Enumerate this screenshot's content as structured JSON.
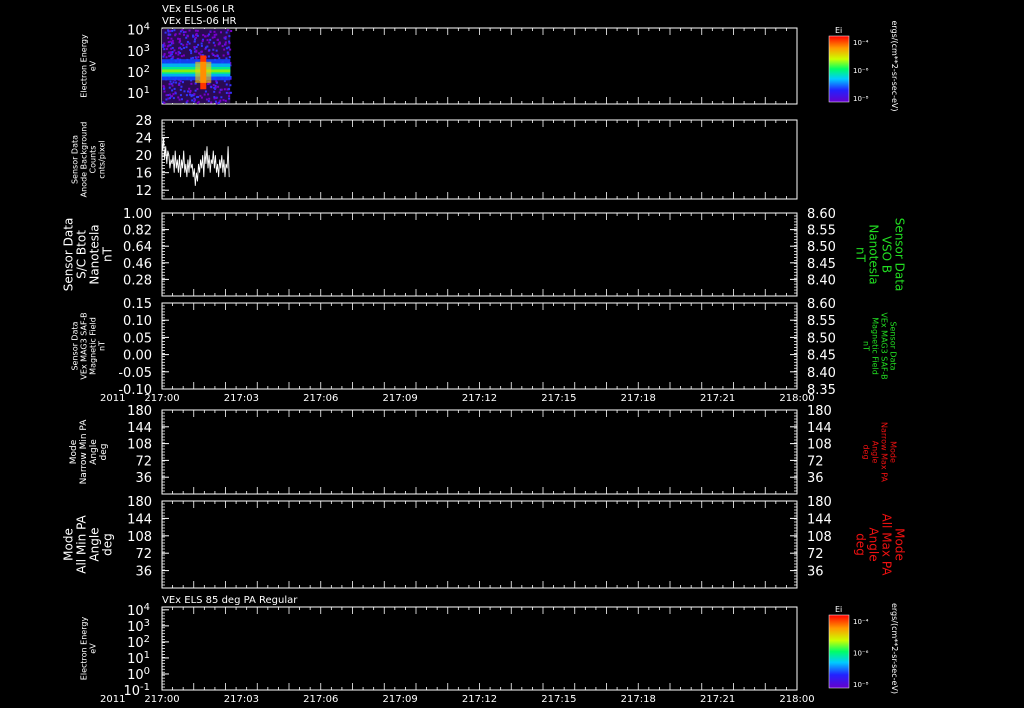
{
  "header": {
    "line1": "VEx ELS-06 LR",
    "line2": "VEx ELS-06 HR"
  },
  "colors": {
    "white": "#ffffff",
    "green": "#22dd22",
    "red": "#ee1111"
  },
  "chart_data": [
    {
      "id": "p1",
      "type": "heatmap",
      "ylabel": [
        "Electron Energy",
        "eV"
      ],
      "yscale": "log",
      "ylim": [
        3,
        12000
      ],
      "yticks": [
        {
          "v": 10,
          "e": "1"
        },
        {
          "v": 100,
          "e": "2"
        },
        {
          "v": 1000,
          "e": "3"
        },
        {
          "v": 10000,
          "e": "4"
        }
      ],
      "data_extent_minutes": [
        0,
        6.45
      ],
      "colorbar": {
        "label": "Ei",
        "ticks": [
          "10⁻⁴",
          "10⁻⁶",
          "10⁻⁸"
        ]
      },
      "right_label": "ergs/(cm**2-sr-sec-eV)"
    },
    {
      "id": "p2",
      "type": "line",
      "ylabel": [
        "Sensor Data",
        "Anode Background",
        "Counts",
        "cnts/pixel"
      ],
      "ylim": [
        10,
        28
      ],
      "yticks": [
        12,
        16,
        20,
        24,
        28
      ],
      "x_minutes": [
        0.05,
        0.15,
        0.25,
        0.35,
        0.45,
        0.55,
        0.65,
        0.75,
        0.85,
        0.95,
        1.05,
        1.15,
        1.25,
        1.35,
        1.45,
        1.55,
        1.65,
        1.75,
        1.85,
        1.95,
        2.05,
        2.15,
        2.25,
        2.35,
        2.45,
        2.55,
        2.65,
        2.75,
        2.85,
        2.95,
        3.05,
        3.15,
        3.25,
        3.35,
        3.45,
        3.55,
        3.65,
        3.75,
        3.85,
        3.95,
        4.05,
        4.15,
        4.25,
        4.35,
        4.45,
        4.55,
        4.65,
        4.75,
        4.85,
        4.95,
        5.05,
        5.15,
        5.25,
        5.35,
        5.45,
        5.55,
        5.65,
        5.75,
        5.85,
        5.95,
        6.05,
        6.15,
        6.25,
        6.35
      ],
      "values": [
        21,
        24,
        19,
        22,
        18,
        21,
        20,
        17,
        19,
        18,
        20,
        16,
        21,
        17,
        19,
        16,
        20,
        15,
        19,
        17,
        21,
        16,
        18,
        15,
        19,
        16,
        20,
        17,
        18,
        15,
        17,
        13,
        16,
        14,
        18,
        16,
        19,
        17,
        20,
        15,
        21,
        18,
        22,
        17,
        20,
        16,
        19,
        18,
        21,
        17,
        20,
        16,
        18,
        15,
        19,
        17,
        20,
        16,
        19,
        15,
        18,
        17,
        22,
        15
      ]
    },
    {
      "id": "p3",
      "type": "line",
      "ylabel": [
        "Sensor Data",
        "S/C Btot",
        "Nanotesla",
        "nT"
      ],
      "ylim": [
        0.1,
        1.0
      ],
      "yticks": [
        "1.00",
        "0.82",
        "0.64",
        "0.46",
        "0.28"
      ],
      "right_ylabel": [
        "Sensor Data",
        "VSO B",
        "Nanotesla",
        "nT"
      ],
      "right_ylim": [
        8.35,
        8.6
      ],
      "right_yticks": [
        "8.60",
        "8.55",
        "8.50",
        "8.45",
        "8.40"
      ]
    },
    {
      "id": "p4",
      "type": "line",
      "ylabel": [
        "Sensor Data",
        "VEx MAG3 SAF-B",
        "Magnetic Field",
        "nT"
      ],
      "ylim": [
        -0.1,
        0.15
      ],
      "yticks": [
        "0.15",
        "0.10",
        "0.05",
        "0.00",
        "-0.05",
        "-0.10"
      ],
      "right_ylabel": [
        "Sensor Data",
        "VEx MAG3 SAF-B",
        "Magnetic Field",
        "nT"
      ],
      "right_ylim": [
        8.35,
        8.6
      ],
      "right_yticks": [
        "8.60",
        "8.55",
        "8.50",
        "8.45",
        "8.40",
        "8.35"
      ],
      "xaxis": {
        "year": "2011",
        "ticks": [
          "217:00",
          "217:03",
          "217:06",
          "217:09",
          "217:12",
          "217:15",
          "217:18",
          "217:21",
          "218:00"
        ]
      }
    },
    {
      "id": "p5",
      "type": "line",
      "ylabel": [
        "Mode",
        "Narrow Min PA",
        "Angle",
        "deg"
      ],
      "ylim": [
        0,
        180
      ],
      "yticks": [
        "180",
        "144",
        "108",
        "72",
        "36"
      ],
      "right_ylabel": [
        "Mode",
        "Narrow Max PA",
        "Angle",
        "deg"
      ],
      "right_yticks": [
        "180",
        "144",
        "108",
        "72",
        "36"
      ]
    },
    {
      "id": "p6",
      "type": "line",
      "ylabel": [
        "Mode",
        "All Min PA",
        "Angle",
        "deg"
      ],
      "ylim": [
        0,
        180
      ],
      "yticks": [
        "180",
        "144",
        "108",
        "72",
        "36"
      ],
      "right_ylabel": [
        "Mode",
        "All Max PA",
        "Angle",
        "deg"
      ],
      "right_yticks": [
        "180",
        "144",
        "108",
        "72",
        "36"
      ]
    },
    {
      "id": "p7",
      "type": "heatmap",
      "title": "VEx ELS 85 deg PA Regular",
      "ylabel": [
        "Electron Energy",
        "eV"
      ],
      "yscale": "log",
      "ylim": [
        0.1,
        15000
      ],
      "yticks": [
        {
          "v": 0.1,
          "e": "-1"
        },
        {
          "v": 1,
          "e": "0"
        },
        {
          "v": 10,
          "e": "1"
        },
        {
          "v": 100,
          "e": "2"
        },
        {
          "v": 1000,
          "e": "3"
        },
        {
          "v": 10000,
          "e": "4"
        }
      ],
      "colorbar": {
        "label": "Ei",
        "ticks": [
          "10⁻⁴",
          "10⁻⁶",
          "10⁻⁸"
        ]
      },
      "right_label": "ergs/(cm**2-sr-sec-eV)",
      "xaxis": {
        "year": "2011",
        "ticks": [
          "217:00",
          "217:03",
          "217:06",
          "217:09",
          "217:12",
          "217:15",
          "217:18",
          "217:21",
          "218:00"
        ]
      }
    }
  ]
}
